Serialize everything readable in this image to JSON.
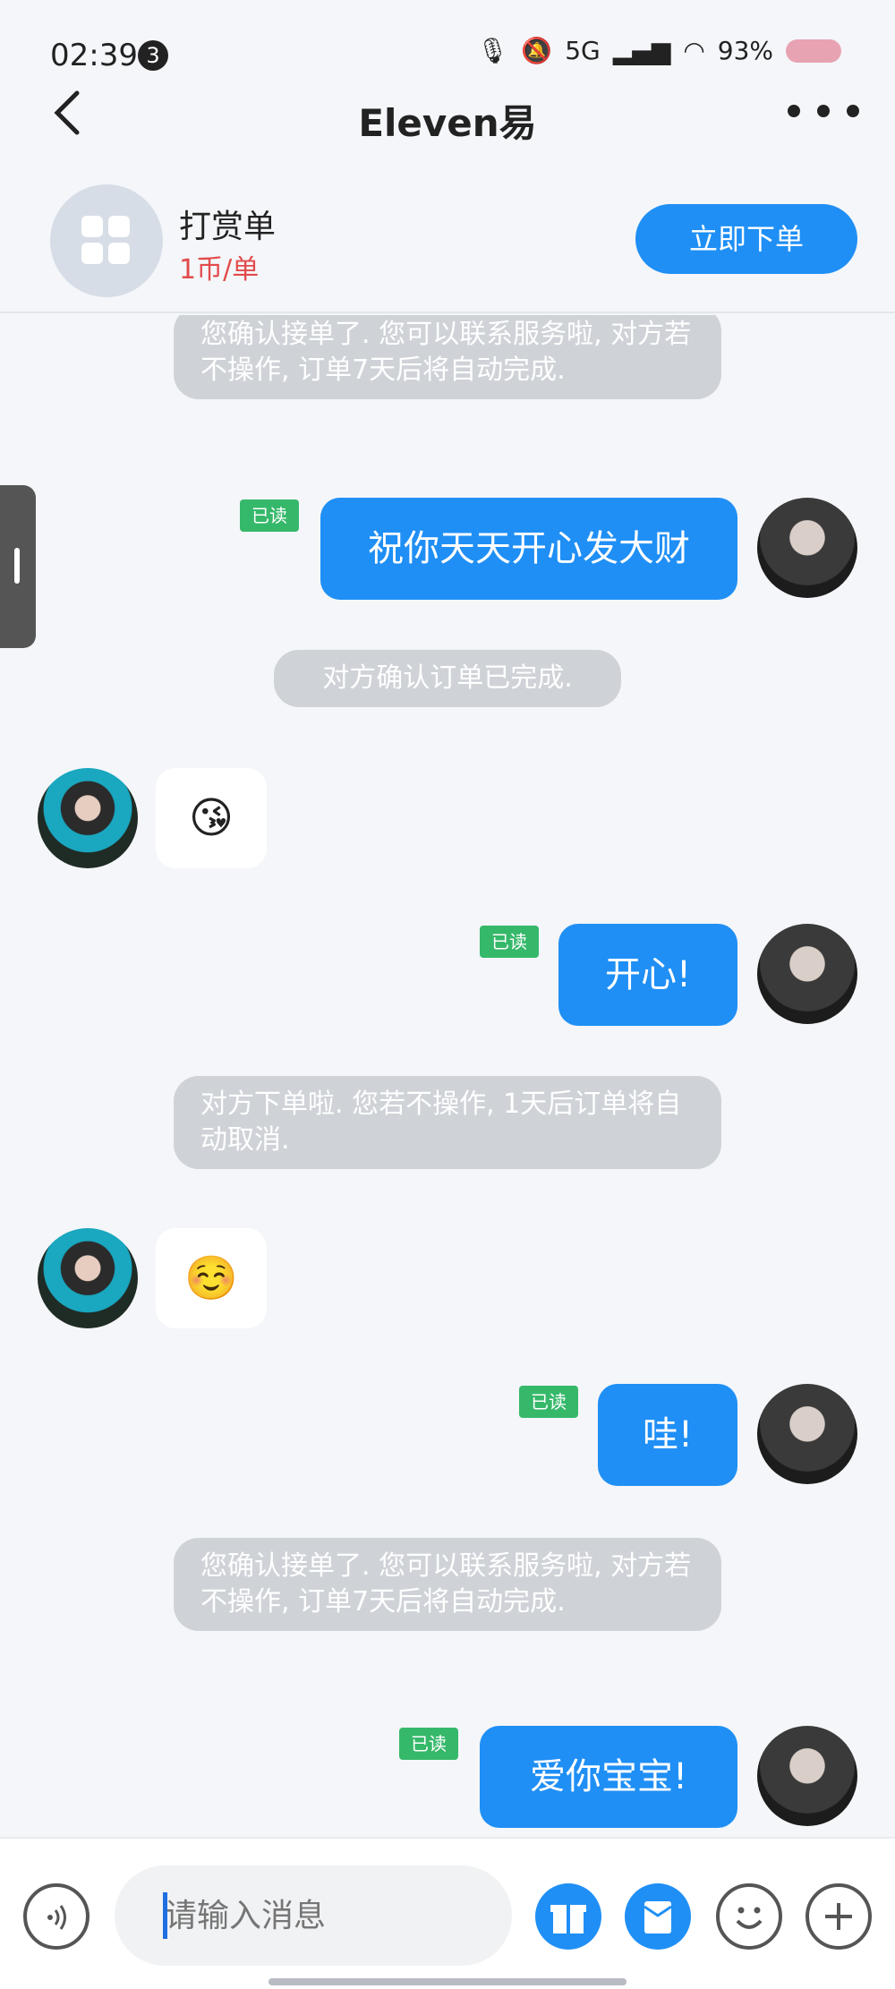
{
  "status_bar": {
    "time": "02:39",
    "notification_count": "3",
    "network": "5G",
    "battery": "93%"
  },
  "nav": {
    "title": "Eleven易"
  },
  "product": {
    "name": "打赏单",
    "price": "1币/单",
    "buy_label": "立即下单"
  },
  "messages": {
    "sys1": "您确认接单了. 您可以联系服务啦, 对方若不操作, 订单7天后将自动完成.",
    "m1": {
      "text": "祝你天天开心发大财",
      "badge": "已读"
    },
    "sys2": "对方确认订单已完成.",
    "e1": "😘",
    "m2": {
      "text": "开心!",
      "badge": "已读"
    },
    "sys3": "对方下单啦. 您若不操作, 1天后订单将自动取消.",
    "e2": "☺️",
    "m3": {
      "text": "哇!",
      "badge": "已读"
    },
    "sys4": "您确认接单了. 您可以联系服务啦, 对方若不操作, 订单7天后将自动完成.",
    "m4": {
      "text": "爱你宝宝!",
      "badge": "已读"
    }
  },
  "input": {
    "placeholder": "请输入消息"
  },
  "colors": {
    "accent": "#1f8ff5",
    "read_badge": "#36b86a",
    "price": "#e24b4b"
  }
}
